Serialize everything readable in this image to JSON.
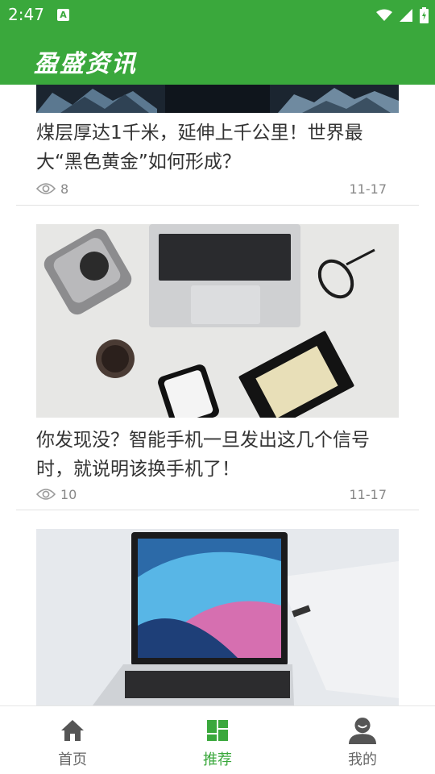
{
  "status_bar": {
    "time": "2:47",
    "app_icon_letter": "A"
  },
  "app_bar": {
    "title": "盈盛资讯"
  },
  "articles": [
    {
      "title": "煤层厚达1千米，延伸上千公里！世界最大“黑色黄金”如何形成？",
      "views": "8",
      "date": "11-17"
    },
    {
      "title": "你发现没？智能手机一旦发出这几个信号时，就说明该换手机了！",
      "views": "10",
      "date": "11-17"
    },
    {
      "title": "",
      "views": "",
      "date": ""
    }
  ],
  "bottom_nav": [
    {
      "label": "首页",
      "icon": "home-icon",
      "active": false
    },
    {
      "label": "推荐",
      "icon": "grid-icon",
      "active": true
    },
    {
      "label": "我的",
      "icon": "profile-icon",
      "active": false
    }
  ],
  "colors": {
    "primary": "#3aa83c",
    "text": "#333333",
    "muted": "#888888"
  }
}
